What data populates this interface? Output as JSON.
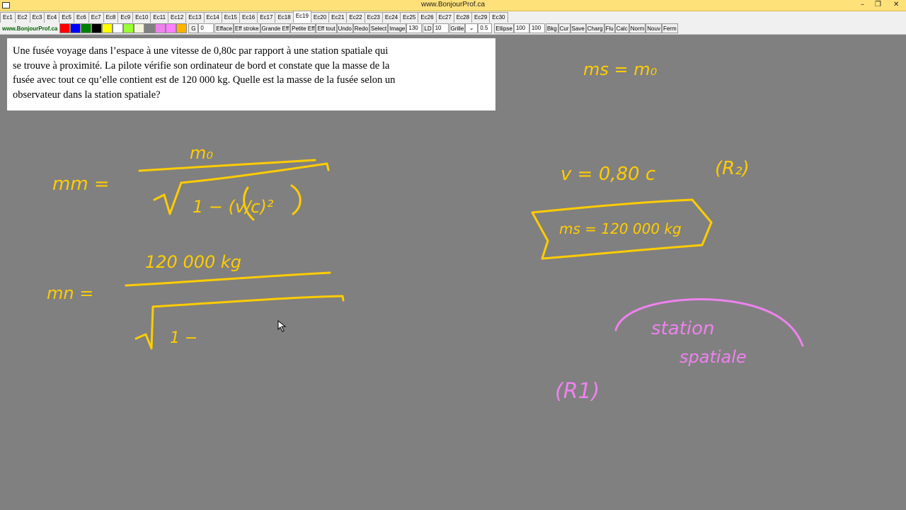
{
  "window": {
    "title": "www.BonjourProf.ca",
    "controls": [
      "–",
      "❐",
      "✕"
    ]
  },
  "tabs": [
    "Ec1",
    "Ec2",
    "Ec3",
    "Ec4",
    "Ec5",
    "Ec6",
    "Ec7",
    "Ec8",
    "Ec9",
    "Ec10",
    "Ec11",
    "Ec12",
    "Ec13",
    "Ec14",
    "Ec15",
    "Ec16",
    "Ec17",
    "Ec18",
    "Ec19",
    "Ec20",
    "Ec21",
    "Ec22",
    "Ec23",
    "Ec24",
    "Ec25",
    "Ec26",
    "Ec27",
    "Ec28",
    "Ec29",
    "Ec30"
  ],
  "active_tab": "Ec19",
  "toolbar": {
    "brand": "www.BonjourProf.ca",
    "colors": [
      "#ff0000",
      "#0000ff",
      "#008000",
      "#000000",
      "#ffff00",
      "#ffffff",
      "#99ff33",
      "#f5f5dc",
      "#808080",
      "#ee82ee",
      "#ff80ff",
      "#ffb300"
    ],
    "g_label": "G",
    "g_value": "0",
    "efface": "Efface",
    "eff_stroke": "Eff stroke",
    "grande_eff": "Grande Eff",
    "petite_eff": "Petite Eff",
    "eff_tout": "Eff tout",
    "undo": "Undo",
    "redo": "Redo",
    "select": "Select",
    "image": "Image",
    "size_value": "130",
    "ld_label": "LD",
    "ld_value": "10",
    "grille": "Grille",
    "grille_dropdown": "⌄",
    "opacity_value": "0.5",
    "ellipse": "Ellipse",
    "ellipse_w": "100",
    "ellipse_h": "100",
    "bkg": "Bkg",
    "cur": "Cur",
    "save": "Save",
    "charg": "Charg",
    "flu": "Flu",
    "calc": "Calc",
    "norm": "Norm",
    "nouv": "Nouv",
    "ferm": "Ferm"
  },
  "problem": {
    "line1": "Une fusée voyage dans l’espace à une vitesse de 0,80c par rapport à une station spatiale qui",
    "line2": "se trouve à proximité. La pilote vérifie son ordinateur de bord et constate que la masse de la",
    "line3": "fusée avec tout ce qu’elle contient est de 120 000 kg. Quelle est la masse de la fusée selon un",
    "line4": "observateur dans la station spatiale?"
  },
  "handwriting": {
    "formula_numerator": "m₀",
    "formula_lhs": "mm =",
    "sqrt_content": "1 − (v/c)²",
    "numeric_numerator": "120 000 kg",
    "numeric_lhs": "mn =",
    "numeric_sqrt": "1 −",
    "ms_eq_m0": "ms = m₀",
    "velocity": "v = 0,80 c",
    "frame_r2": "(R₂)",
    "boxed_mass": "ms = 120 000 kg",
    "station_label_1": "station",
    "station_label_2": "spatiale",
    "frame_r1": "(R1)"
  },
  "ink_colors": {
    "yellow": "#ffcc00",
    "pink": "#ee82ee"
  }
}
